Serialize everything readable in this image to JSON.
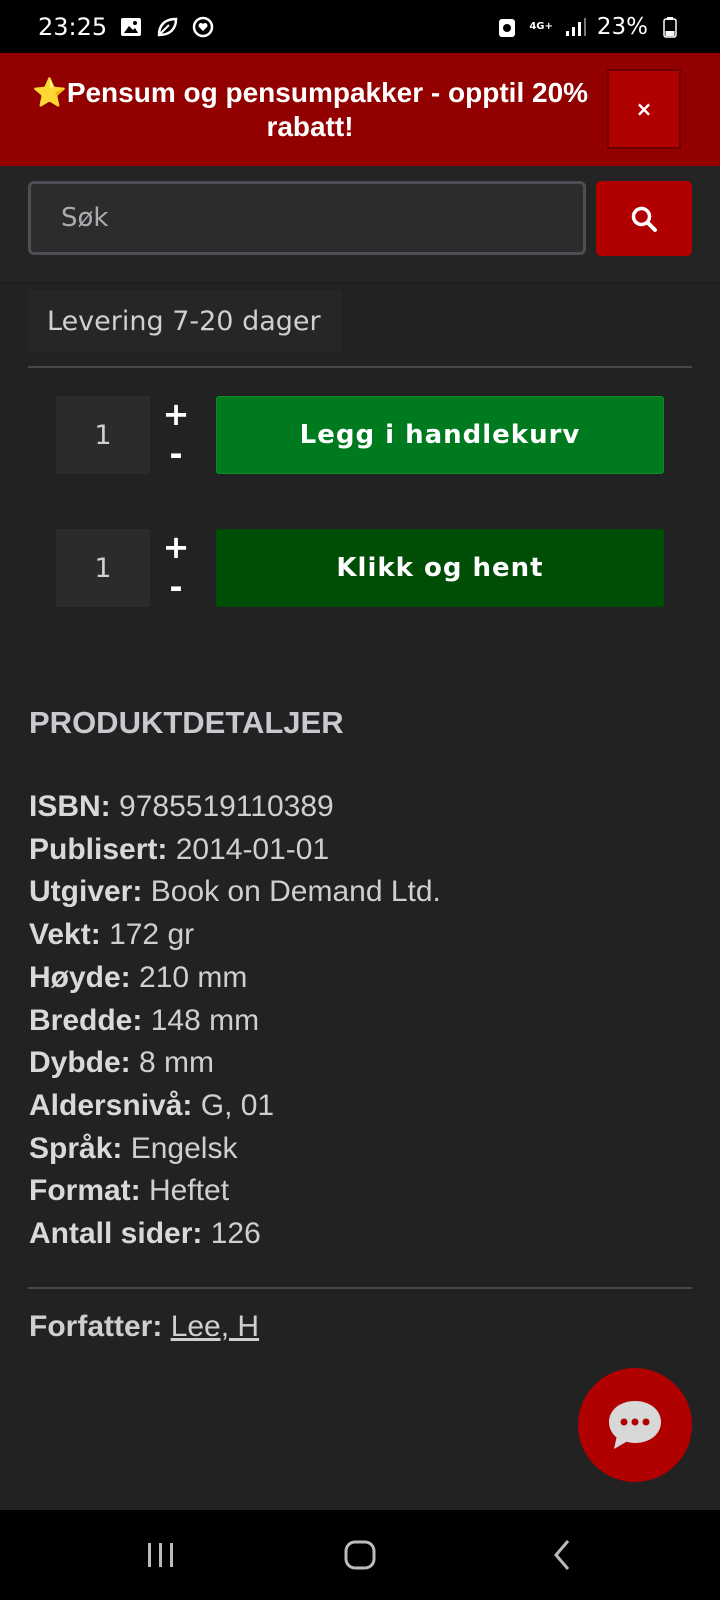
{
  "statusbar": {
    "time": "23:25",
    "network": "4G+",
    "battery": "23%"
  },
  "banner": {
    "star": "⭐",
    "text": "Pensum og pensumpakker - opptil 20% rabatt!",
    "close_label": "×"
  },
  "search": {
    "placeholder": "Søk"
  },
  "delivery": "Levering 7-20 dager",
  "purchase": {
    "cart_qty": "1",
    "cart_label": "Legg i handlekurv",
    "pickup_qty": "1",
    "pickup_label": "Klikk og hent",
    "plus": "+",
    "minus": "-"
  },
  "details": {
    "title": "PRODUKTDETALJER",
    "rows": [
      {
        "label": "ISBN:",
        "value": "9785519110389"
      },
      {
        "label": "Publisert:",
        "value": "2014-01-01"
      },
      {
        "label": "Utgiver:",
        "value": "Book on Demand Ltd."
      },
      {
        "label": "Vekt:",
        "value": "172 gr"
      },
      {
        "label": "Høyde:",
        "value": "210 mm"
      },
      {
        "label": "Bredde:",
        "value": "148 mm"
      },
      {
        "label": "Dybde:",
        "value": "8 mm"
      },
      {
        "label": "Aldersnivå:",
        "value": "G, 01"
      },
      {
        "label": "Språk:",
        "value": "Engelsk"
      },
      {
        "label": "Format:",
        "value": "Heftet"
      },
      {
        "label": "Antall sider:",
        "value": "126"
      }
    ],
    "author_label": "Forfatter:",
    "author_name": "Lee, H"
  },
  "colors": {
    "background": "#222222",
    "banner": "#920000",
    "accent_red": "#b00000",
    "cart_green": "#007a1e",
    "pickup_green": "#004d06"
  }
}
